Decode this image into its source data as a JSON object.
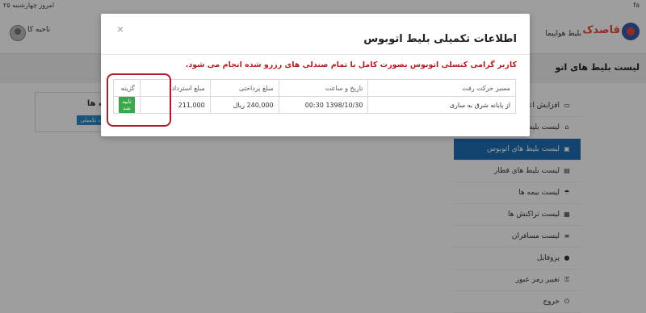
{
  "topbar": {
    "date_text": "امروز چهارشنبه ۲۵",
    "corner_mark": "fa"
  },
  "header": {
    "logo_text": "قاصدک",
    "nav": [
      "بلیط هواپیما",
      "ب"
    ],
    "user_name": "ناحیه کا"
  },
  "page_title": "لیست بلیط های اتو",
  "sidebar": {
    "items": [
      {
        "icon": "credit-card-icon",
        "glyph": "▭",
        "label": "افزایش اعتبار"
      },
      {
        "icon": "home-icon",
        "glyph": "⌂",
        "label": "لیست بلیط ها"
      },
      {
        "icon": "bus-icon",
        "glyph": "▣",
        "label": "لیست بلیط های اتوبوس",
        "active": true
      },
      {
        "icon": "train-icon",
        "glyph": "▤",
        "label": "لیست بلیط های قطار"
      },
      {
        "icon": "umbrella-icon",
        "glyph": "☂",
        "label": "لیست بیمه ها"
      },
      {
        "icon": "money-icon",
        "glyph": "▦",
        "label": "لیست تراکنش ها"
      },
      {
        "icon": "list-icon",
        "glyph": "≡",
        "label": "لیست مسافران"
      },
      {
        "icon": "user-icon",
        "glyph": "●",
        "label": "پروفایل"
      },
      {
        "icon": "key-icon",
        "glyph": "⚿",
        "label": "تغییر رمز عبور"
      },
      {
        "icon": "power-icon",
        "glyph": "⏻",
        "label": "خروج"
      }
    ]
  },
  "options_panel": {
    "title": "گزینه ها",
    "button": "اطلاعات تکمیلی"
  },
  "modal": {
    "close_glyph": "×",
    "title": "اطلاعات تکمیلی بلیط اتوبوس",
    "message": "کاربر گرامی کنسلی اتوبوس بصورت کامل با تمام صندلی های رزرو شده انجام می شود.",
    "table": {
      "headers": [
        "مسیر حرکت رفت",
        "تاریخ و ساعت",
        "مبلغ پرداختی",
        "مبلغ استرداد",
        "گزینه"
      ],
      "row": {
        "route": "از پایانه شرق به ساری",
        "datetime": "1398/10/30 00:30",
        "paid": "240,000 ریال",
        "refund": "211,000",
        "action": "تایید شد"
      }
    }
  },
  "colors": {
    "accent": "#1f6fb5",
    "alert": "#b02020",
    "success": "#3aa84a",
    "highlight": "#b01c2e"
  }
}
